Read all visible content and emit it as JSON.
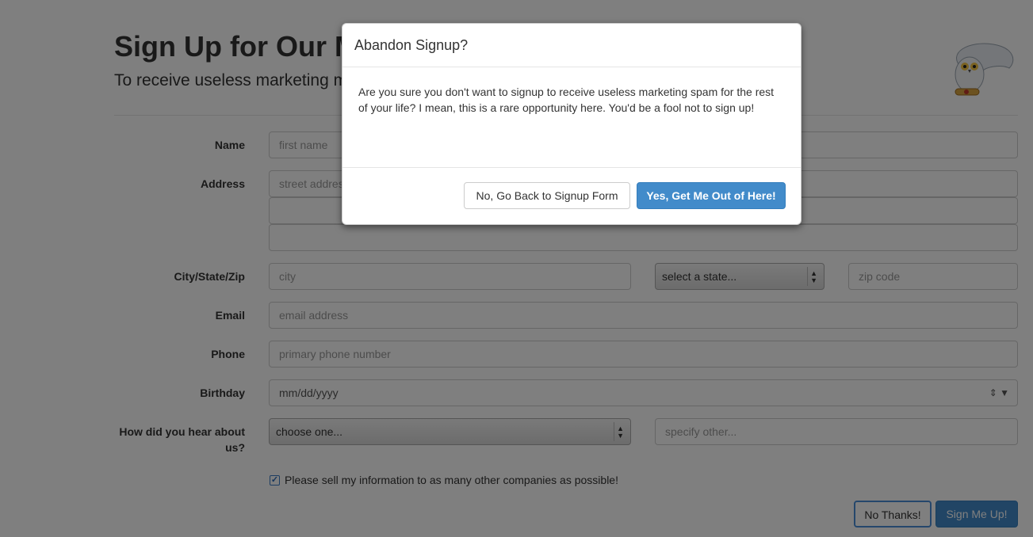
{
  "page": {
    "title": "Sign Up for Our Marketing Emails",
    "subtitle": "To receive useless marketing messages, please complete the following form!"
  },
  "form": {
    "name_label": "Name",
    "first_name_placeholder": "first name",
    "address_label": "Address",
    "street_placeholder": "street address",
    "city_state_zip_label": "City/State/Zip",
    "city_placeholder": "city",
    "state_selected": "select a state...",
    "zip_placeholder": "zip code",
    "email_label": "Email",
    "email_placeholder": "email address",
    "phone_label": "Phone",
    "phone_placeholder": "primary phone number",
    "birthday_label": "Birthday",
    "birthday_value": "mm/dd/yyyy",
    "hear_label": "How did you hear about us?",
    "hear_selected": "choose one...",
    "other_placeholder": "specify other...",
    "checkbox_label": "Please sell my information to as many other companies as possible!",
    "checkbox_checked": true,
    "no_thanks_label": "No Thanks!",
    "sign_up_label": "Sign Me Up!"
  },
  "modal": {
    "title": "Abandon Signup?",
    "body": "Are you sure you don't want to signup to receive useless marketing spam for the rest of your life? I mean, this is a rare opportunity here. You'd be a fool not to sign up!",
    "cancel_label": "No, Go Back to Signup Form",
    "confirm_label": "Yes, Get Me Out of Here!"
  },
  "icons": {
    "owl": "owl-mascot-icon",
    "select_arrows": "updown-arrows-icon",
    "checkmark": "checkmark-icon"
  },
  "colors": {
    "primary": "#428bca",
    "backdrop": "rgba(0,0,0,0.5)"
  }
}
